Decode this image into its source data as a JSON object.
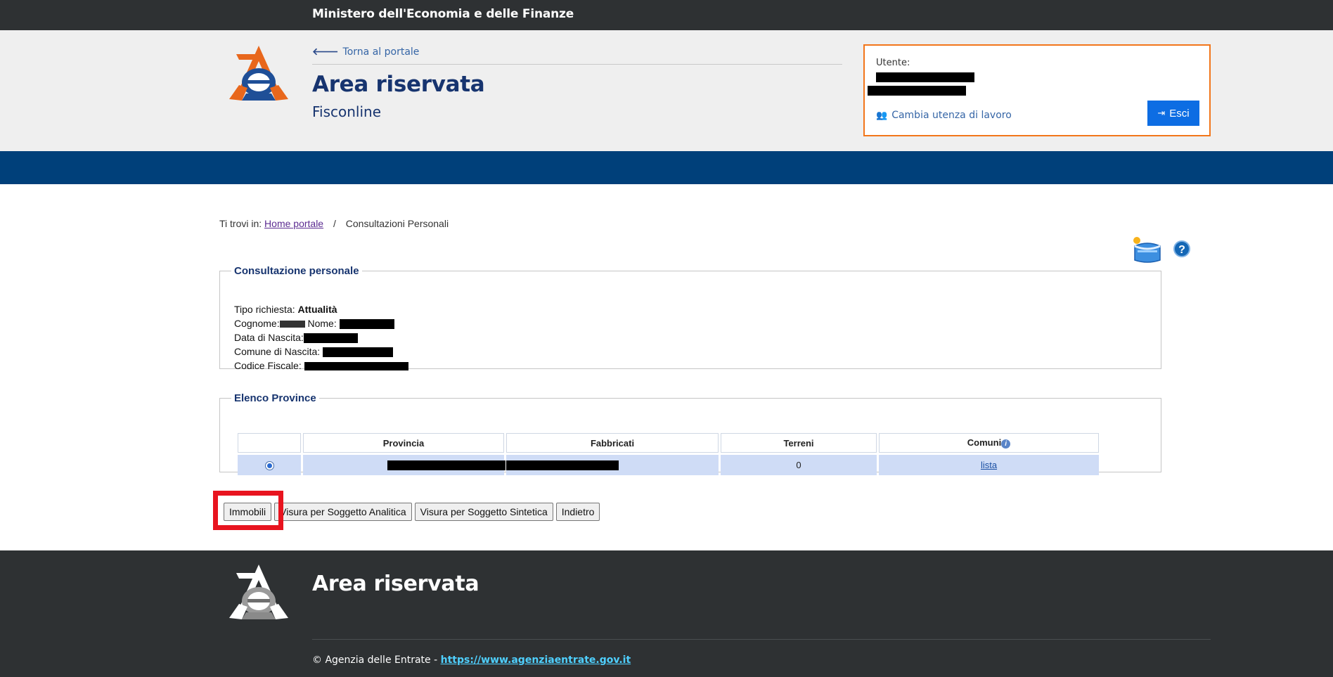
{
  "topbar": {
    "ministry": "Ministero dell'Economia e delle Finanze"
  },
  "header": {
    "back_link": "Torna al portale",
    "title": "Area riservata",
    "subtitle": "Fisconline"
  },
  "userbox": {
    "user_label": "Utente:",
    "change_user": "Cambia utenza di lavoro",
    "exit_button": "Esci"
  },
  "breadcrumb": {
    "prefix": "Ti trovi in:",
    "home": "Home portale",
    "separator": "/",
    "current": "Consultazioni Personali"
  },
  "consultazione": {
    "legend": "Consultazione personale",
    "tipo_label": "Tipo richiesta:",
    "tipo_value": "Attualità",
    "cognome_label": "Cognome:",
    "nome_label": "Nome:",
    "nascita_label": "Data di Nascita:",
    "comune_label": "Comune di Nascita:",
    "cf_label": "Codice Fiscale:"
  },
  "province": {
    "legend": "Elenco Province",
    "headers": [
      "",
      "Provincia",
      "Fabbricati",
      "Terreni",
      "Comuni"
    ],
    "rows": [
      {
        "terreni": "0",
        "comuni_link": "lista"
      }
    ]
  },
  "buttons": {
    "immobili": "Immobili",
    "analitica": "Visura per Soggetto Analitica",
    "sintetica": "Visura per Soggetto Sintetica",
    "indietro": "Indietro"
  },
  "footer": {
    "title": "Area riservata",
    "copyright": "© Agenzia delle Entrate - ",
    "link": "https://www.agenziaentrate.gov.it"
  },
  "colors": {
    "header_blue": "#00407a",
    "title_blue": "#17346f",
    "accent_orange": "#f2761a",
    "exit_blue": "#0d6de3",
    "highlight_red": "#e8141f",
    "dark_bar": "#2e3133"
  },
  "icons": [
    "arrow-left-icon",
    "users-icon",
    "sign-out-icon",
    "toolbox-icon",
    "help-icon",
    "info-icon",
    "agenzia-logo"
  ]
}
